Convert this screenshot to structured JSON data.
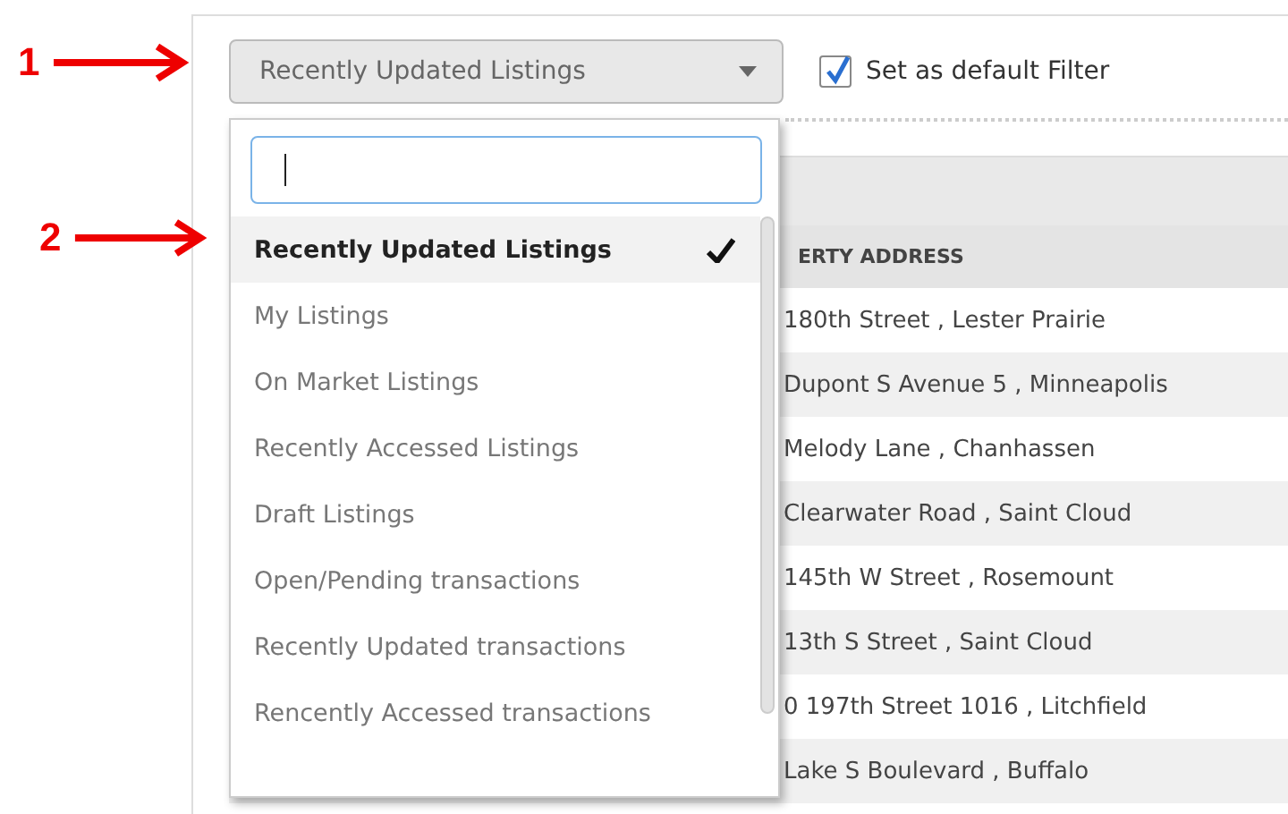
{
  "annotations": [
    {
      "label": "1"
    },
    {
      "label": "2"
    }
  ],
  "filter": {
    "value": "Recently Updated Listings",
    "options": [
      {
        "label": "Recently Updated Listings",
        "selected": true
      },
      {
        "label": "My Listings",
        "selected": false
      },
      {
        "label": "On Market Listings",
        "selected": false
      },
      {
        "label": "Recently Accessed Listings",
        "selected": false
      },
      {
        "label": "Draft Listings",
        "selected": false
      },
      {
        "label": "Open/Pending transactions",
        "selected": false
      },
      {
        "label": "Recently Updated transactions",
        "selected": false
      },
      {
        "label": "Rencently Accessed transactions",
        "selected": false
      }
    ]
  },
  "default_filter": {
    "label": "Set as default Filter",
    "checked": true
  },
  "table": {
    "columns": [
      "ERTY ADDRESS"
    ],
    "rows": [
      "180th Street , Lester Prairie",
      "Dupont S Avenue 5 , Minneapolis",
      "Melody Lane , Chanhassen",
      "Clearwater Road , Saint Cloud",
      "145th W Street , Rosemount",
      "13th S Street , Saint Cloud",
      "0 197th Street 1016 , Litchfield",
      "Lake S Boulevard , Buffalo"
    ]
  }
}
